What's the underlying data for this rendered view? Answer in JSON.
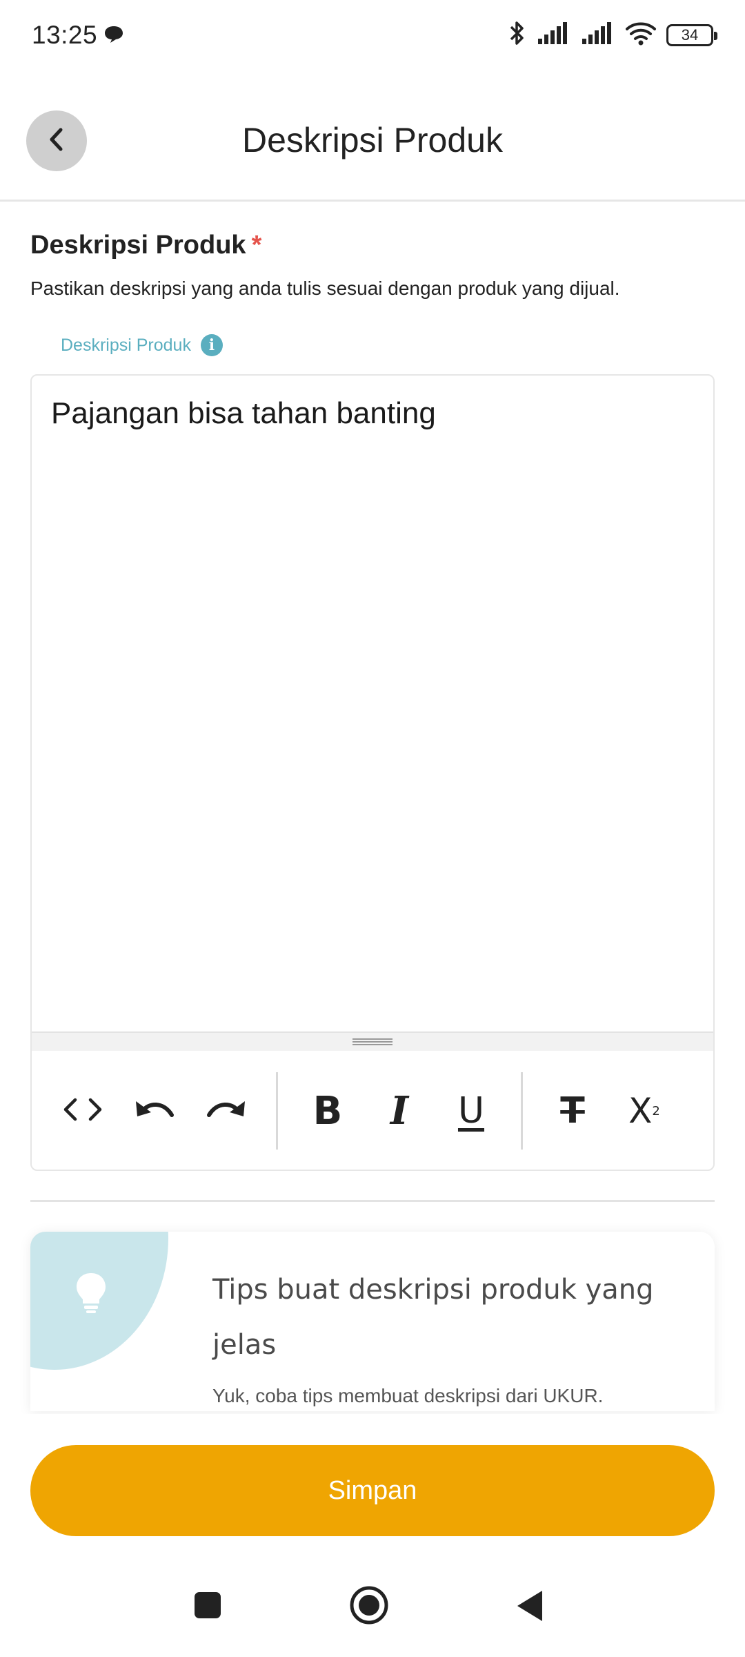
{
  "status_bar": {
    "time": "13:25",
    "battery": "34"
  },
  "header": {
    "title": "Deskripsi Produk"
  },
  "section": {
    "title": "Deskripsi Produk",
    "required_mark": "*",
    "description": "Pastikan deskripsi yang anda tulis sesuai dengan produk yang dijual."
  },
  "editor": {
    "label": "Deskripsi Produk",
    "info_glyph": "i",
    "content": "Pajangan bisa tahan banting",
    "toolbar": {
      "bold": "B",
      "italic": "I",
      "underline": "U",
      "strikethrough": "T",
      "superscript_base": "X",
      "superscript_mark": "2"
    }
  },
  "tips": {
    "title": "Tips buat deskripsi produk yang jelas",
    "subtitle": "Yuk, coba tips membuat deskripsi dari UKUR."
  },
  "actions": {
    "save_label": "Simpan"
  },
  "colors": {
    "accent": "#efa502",
    "teal": "#5aaebf",
    "required": "#e5534b"
  },
  "icons": [
    "message-icon",
    "bluetooth-icon",
    "signal-icon",
    "wifi-icon",
    "battery-icon",
    "back-arrow-icon",
    "info-icon",
    "code-view-icon",
    "undo-icon",
    "redo-icon",
    "lightbulb-icon",
    "nav-recents-icon",
    "nav-home-icon",
    "nav-back-icon"
  ]
}
